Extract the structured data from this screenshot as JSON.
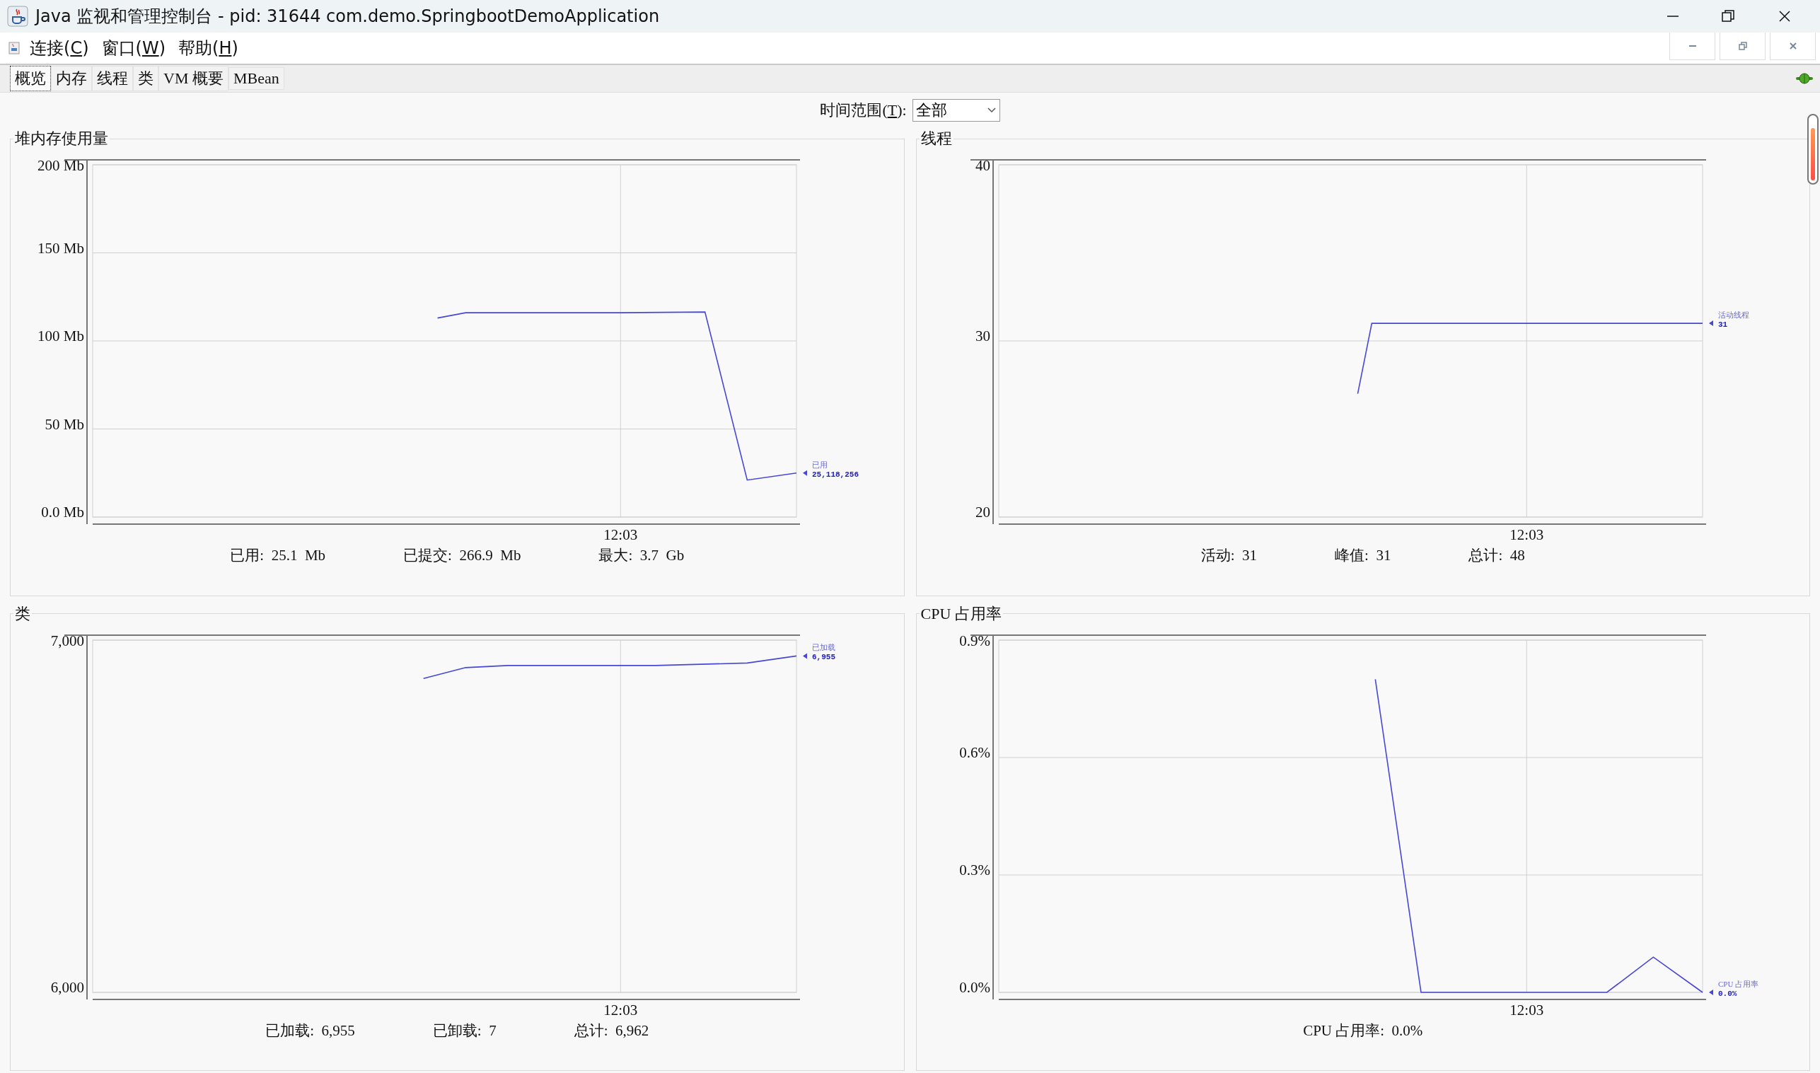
{
  "window": {
    "title": "Java 监视和管理控制台 - pid: 31644 com.demo.SpringbootDemoApplication"
  },
  "menus": [
    {
      "label": "连接(C)"
    },
    {
      "label": "窗口(W)"
    },
    {
      "label": "帮助(H)"
    }
  ],
  "tabs": [
    {
      "label": "概览",
      "selected": true
    },
    {
      "label": "内存",
      "selected": false
    },
    {
      "label": "线程",
      "selected": false
    },
    {
      "label": "类",
      "selected": false
    },
    {
      "label": "VM 概要",
      "selected": false
    },
    {
      "label": "MBean",
      "selected": false
    }
  ],
  "time_range": {
    "label": "时间范围(T):",
    "value": "全部"
  },
  "panels": [
    {
      "title": "堆内存使用量",
      "y_labels": [
        "200 Mb",
        "150 Mb",
        "100 Mb",
        "50 Mb",
        "0.0 Mb"
      ],
      "x_label": "12:03",
      "legend": {
        "name": "已用",
        "value": "25,118,256"
      },
      "stats": [
        {
          "label": "已用:",
          "value": "25.1  Mb"
        },
        {
          "label": "已提交:",
          "value": "266.9  Mb"
        },
        {
          "label": "最大:",
          "value": "3.7  Gb"
        }
      ]
    },
    {
      "title": "线程",
      "y_labels": [
        "40",
        "30",
        "20"
      ],
      "x_label": "12:03",
      "legend": {
        "name": "活动线程",
        "value": "31"
      },
      "stats": [
        {
          "label": "活动:",
          "value": "31"
        },
        {
          "label": "峰值:",
          "value": "31"
        },
        {
          "label": "总计:",
          "value": "48"
        }
      ]
    },
    {
      "title": "类",
      "y_labels": [
        "7,000",
        "6,000"
      ],
      "x_label": "12:03",
      "legend": {
        "name": "已加载",
        "value": "6,955"
      },
      "stats": [
        {
          "label": "已加载:",
          "value": "6,955"
        },
        {
          "label": "已卸载:",
          "value": "7"
        },
        {
          "label": "总计:",
          "value": "6,962"
        }
      ]
    },
    {
      "title": "CPU 占用率",
      "y_labels": [
        "0.9%",
        "0.6%",
        "0.3%",
        "0.0%"
      ],
      "x_label": "12:03",
      "legend": {
        "name": "CPU 占用率",
        "value": "0.0%"
      },
      "stats": [
        {
          "label": "CPU 占用率:",
          "value": "0.0%"
        }
      ]
    }
  ]
}
